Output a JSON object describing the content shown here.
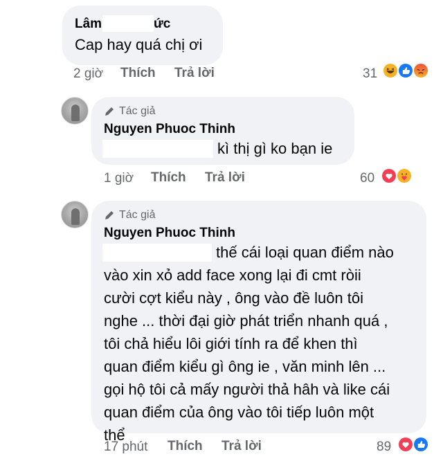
{
  "comments": [
    {
      "author": "Lâm",
      "author_suffix": "ức",
      "text": "Cap hay quá chị ơi",
      "time": "2 giờ",
      "like_label": "Thích",
      "reply_label": "Trả lời",
      "reaction_count": "31",
      "reactions": [
        "haha-icon",
        "like-icon",
        "angry-icon"
      ]
    },
    {
      "badge": "Tác giả",
      "author": "Nguyen Phuoc Thinh",
      "text": "kì thị gì ko bạn ie",
      "time": "1 giờ",
      "like_label": "Thích",
      "reply_label": "Trả lời",
      "reaction_count": "60",
      "reactions": [
        "love-icon",
        "care-icon"
      ]
    },
    {
      "badge": "Tác giả",
      "author": "Nguyen Phuoc Thinh",
      "text_lines": [
        "thế cái loại quan điểm nào",
        "vào xin xỏ add face xong lại đi cmt ròii",
        "cười cợt kiểu này , ông vào đề luôn tôi",
        "nghe ... thời đại giờ phát triển nhanh quá ,",
        "tôi chả hiểu lôi giới tính ra để khen thì",
        "quan điểm kiểu gì ông ie , văn minh lên ...",
        "gọi hộ tôi cả mấy người thả hâh và like cái",
        "quan điểm của ông vào tôi tiếp luôn một",
        "thể"
      ],
      "time": "17 phút",
      "like_label": "Thích",
      "reply_label": "Trả lời",
      "reaction_count": "89",
      "reactions": [
        "love-icon",
        "like-icon"
      ]
    }
  ],
  "colors": {
    "bubble": "#f0f2f5",
    "meta": "#65676b",
    "like_blue": "#1877f2",
    "love_red": "#f33e58",
    "haha_yellow": "#f7b125"
  }
}
